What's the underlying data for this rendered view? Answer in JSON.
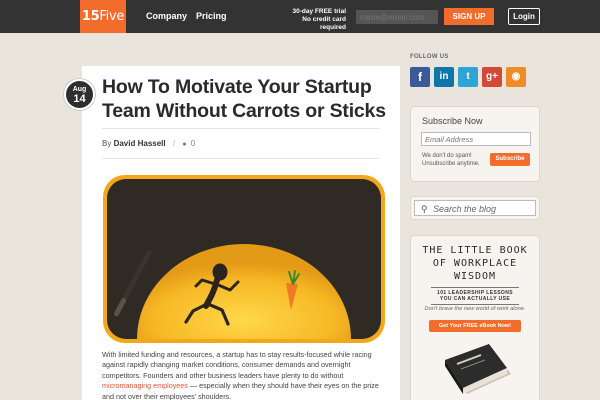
{
  "header": {
    "logo_strong": "15",
    "logo_light": "Five",
    "nav": [
      "Company",
      "Pricing"
    ],
    "trial_line1": "30-day FREE trial",
    "trial_line2": "No credit card required",
    "email_placeholder": "name@email.com",
    "signup_label": "SIGN UP",
    "login_label": "Login"
  },
  "post": {
    "date_month": "Aug",
    "date_day": "14",
    "title": "How To Motivate Your Startup Team Without Carrots or Sticks",
    "by_label": "By",
    "author": "David Hassell",
    "separator": "/",
    "comment_count": "0",
    "body_before_link": "With limited funding and resources, a startup has to stay results-focused while racing against rapidly changing market conditions, consumer demands and overnight competitors. Founders and other business leaders have plenty to do without ",
    "body_link": "micromanaging employees",
    "body_after_link": " — especially when they should have their eyes on the prize and not over their employees' shoulders."
  },
  "sidebar": {
    "follow_label": "FOLLOW US",
    "social": [
      "f",
      "in",
      "t",
      "g+",
      "rss"
    ],
    "subscribe_title": "Subscribe Now",
    "subscribe_placeholder": "Email Address",
    "no_spam_line1": "We don't do spam!",
    "no_spam_line2": "Unsubscribe anytime.",
    "subscribe_button": "Subscribe",
    "search_placeholder": "Search the blog",
    "book_title_lines": [
      "THE LITTLE BOOK",
      "OF WORKPLACE",
      "WISDOM"
    ],
    "book_sub_line1": "101 LEADERSHIP LESSONS",
    "book_sub_line2": "YOU CAN ACTUALLY USE",
    "book_tagline": "Don't brave the new world of work alone.",
    "book_button": "Get Your FREE eBook Now!"
  },
  "colors": {
    "brand_orange": "#f26c2c",
    "topbar": "#333333",
    "page_bg": "#e9e4dc",
    "link": "#e2573b"
  },
  "icons": {
    "comment": "speech-bubble-icon",
    "search": "magnifier-icon",
    "social": [
      "facebook-icon",
      "linkedin-icon",
      "twitter-icon",
      "google-plus-icon",
      "rss-icon"
    ]
  }
}
